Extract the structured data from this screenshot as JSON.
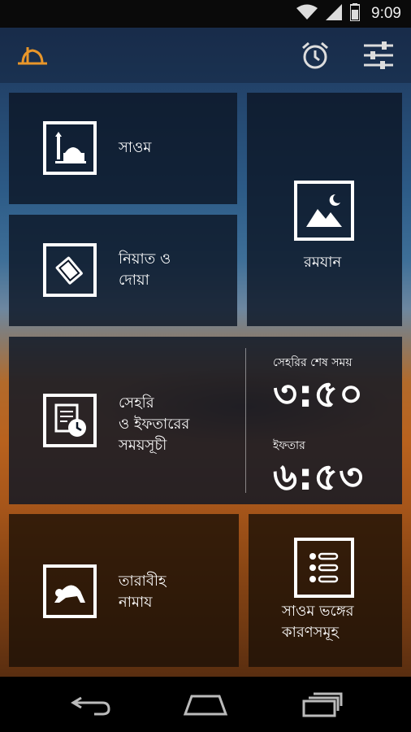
{
  "status_bar": {
    "time": "9:09",
    "icons": [
      "wifi-icon",
      "signal-icon",
      "battery-icon"
    ]
  },
  "action_bar": {
    "logo_icon": "mosque-dome-logo-icon",
    "actions": [
      "alarm-clock-icon",
      "settings-sliders-icon"
    ]
  },
  "tiles": {
    "saom": {
      "label": "সাওম",
      "icon": "mosque-icon"
    },
    "niyat": {
      "label_line1": "নিয়াত ও",
      "label_line2": "দোয়া",
      "icon": "quran-book-icon"
    },
    "ramadan": {
      "label": "রমযান",
      "icon": "crescent-landscape-icon"
    },
    "schedule": {
      "label_line1": "সেহরি",
      "label_line2": "ও ইফতারের",
      "label_line3": "সময়সূচী",
      "icon": "schedule-clock-icon",
      "sehri_label": "সেহরির শেষ সময়",
      "sehri_time": "৩:৫০",
      "iftar_label": "ইফতার",
      "iftar_time": "৬:৫৩"
    },
    "tarabi": {
      "label_line1": "তারাবীহ",
      "label_line2": "নামায",
      "icon": "prayer-prostration-icon"
    },
    "breakers": {
      "label_line1": "সাওম ভঙ্গের",
      "label_line2": "কারণসমূহ",
      "icon": "checklist-icon"
    }
  },
  "nav_bar": {
    "buttons": [
      "back-icon",
      "home-icon",
      "recent-apps-icon"
    ]
  },
  "colors": {
    "tile_bg": "#0c1626",
    "accent_logo": "#e8962a",
    "text": "#ffffff"
  }
}
